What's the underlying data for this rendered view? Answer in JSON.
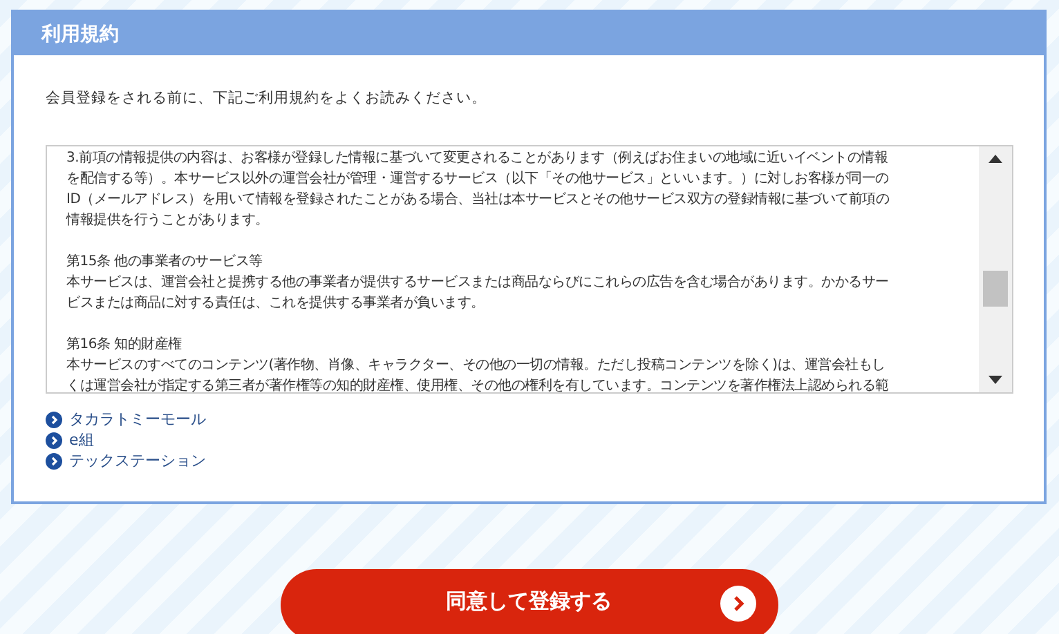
{
  "panel": {
    "title": "利用規約",
    "intro": "会員登録をされる前に、下記ご利用規約をよくお読みください。"
  },
  "terms": [
    {
      "kind": "paragraph",
      "lines": [
        "3.前項の情報提供の内容は、お客様が登録した情報に基づいて変更されることがあります（例えばお住まいの地域に近いイベントの情報",
        "を配信する等）。本サービス以外の運営会社が管理・運営するサービス（以下「その他サービス」といいます。）に対しお客様が同一の",
        "ID（メールアドレス）を用いて情報を登録されたことがある場合、当社は本サービスとその他サービス双方の登録情報に基づいて前項の",
        "情報提供を行うことがあります。"
      ]
    },
    {
      "kind": "heading",
      "lines": [
        "第15条 他の事業者のサービス等"
      ]
    },
    {
      "kind": "paragraph",
      "lines": [
        "本サービスは、運営会社と提携する他の事業者が提供するサービスまたは商品ならびにこれらの広告を含む場合があります。かかるサー",
        "ビスまたは商品に対する責任は、これを提供する事業者が負います。"
      ]
    },
    {
      "kind": "heading",
      "lines": [
        "第16条 知的財産権"
      ]
    },
    {
      "kind": "paragraph",
      "lines": [
        "本サービスのすべてのコンテンツ(著作物、肖像、キャラクター、その他の一切の情報。ただし投稿コンテンツを除く)は、運営会社もし",
        "くは運営会社が指定する第三者が著作権等の知的財産権、使用権、その他の権利を有しています。コンテンツを著作権法上認められる範"
      ]
    }
  ],
  "links": [
    "タカラトミーモール",
    "e組",
    "テックステーション"
  ],
  "agree_button": "同意して登録する"
}
